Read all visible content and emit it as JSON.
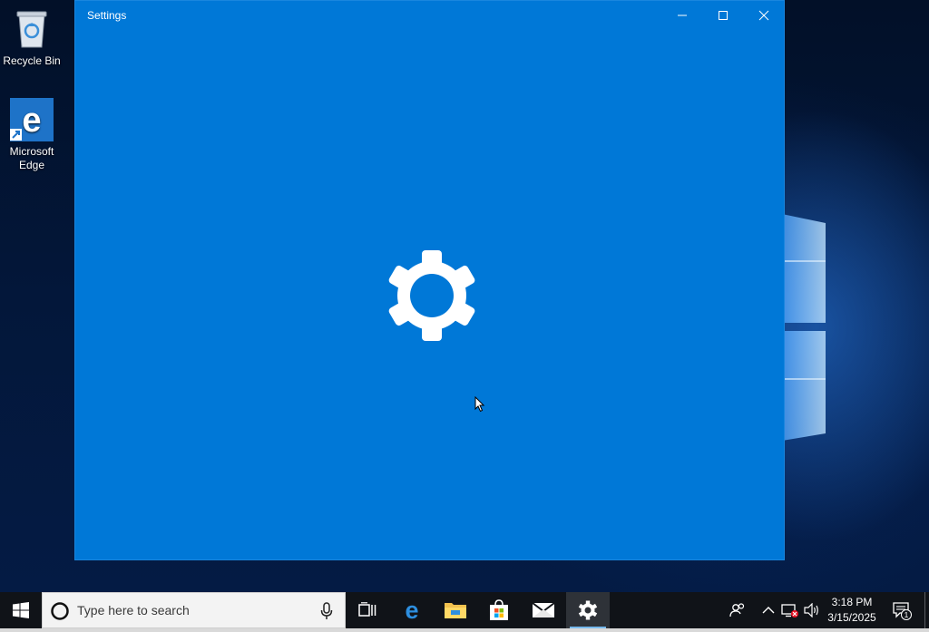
{
  "desktop": {
    "icons": [
      {
        "label": "Recycle Bin",
        "icon": "recycle-bin-icon"
      },
      {
        "label": "Microsoft\nEdge",
        "icon": "edge-icon"
      }
    ]
  },
  "window": {
    "title": "Settings",
    "state": "loading-splash",
    "accent_color": "#0078d7",
    "controls": [
      "minimize-icon",
      "maximize-icon",
      "close-icon"
    ],
    "splash_icon": "gear-icon"
  },
  "taskbar": {
    "start_icon": "windows-start-icon",
    "search": {
      "placeholder": "Type here to search",
      "mic_icon": "microphone-icon"
    },
    "pinned": [
      {
        "name": "task-view",
        "icon": "task-view-icon"
      },
      {
        "name": "edge",
        "icon": "edge-icon"
      },
      {
        "name": "file-explorer",
        "icon": "folder-icon"
      },
      {
        "name": "store",
        "icon": "store-icon"
      },
      {
        "name": "mail",
        "icon": "mail-icon"
      },
      {
        "name": "settings",
        "icon": "gear-icon",
        "active": true
      }
    ],
    "tray": {
      "people_icon": "people-icon",
      "chevron_icon": "chevron-up-icon",
      "network_icon": "network-disconnected-icon",
      "volume_icon": "volume-icon",
      "time": "3:18 PM",
      "date": "3/15/2025",
      "notification_count": "1"
    }
  }
}
